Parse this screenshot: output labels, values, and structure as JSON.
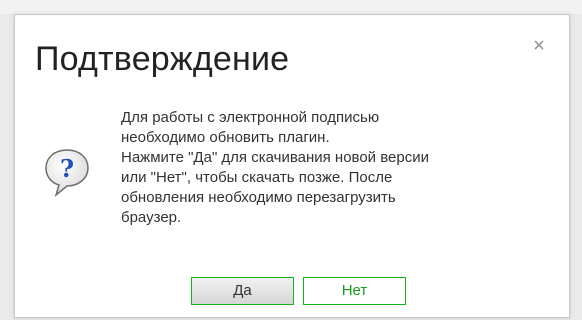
{
  "dialog": {
    "title": "Подтверждение",
    "close_symbol": "×",
    "icon": "question-balloon-icon",
    "message_lines": [
      "Для работы с электронной подписью",
      "необходимо обновить плагин.",
      "Нажмите \"Да\" для скачивания новой версии",
      "или \"Нет\", чтобы скачать позже. После",
      "обновления необходимо перезагрузить",
      "браузер."
    ],
    "buttons": {
      "yes": "Да",
      "no": "Нет"
    }
  },
  "colors": {
    "button_border": "#19b219",
    "no_button_text": "#1a9a1a",
    "icon_blue": "#1f4fb8"
  }
}
